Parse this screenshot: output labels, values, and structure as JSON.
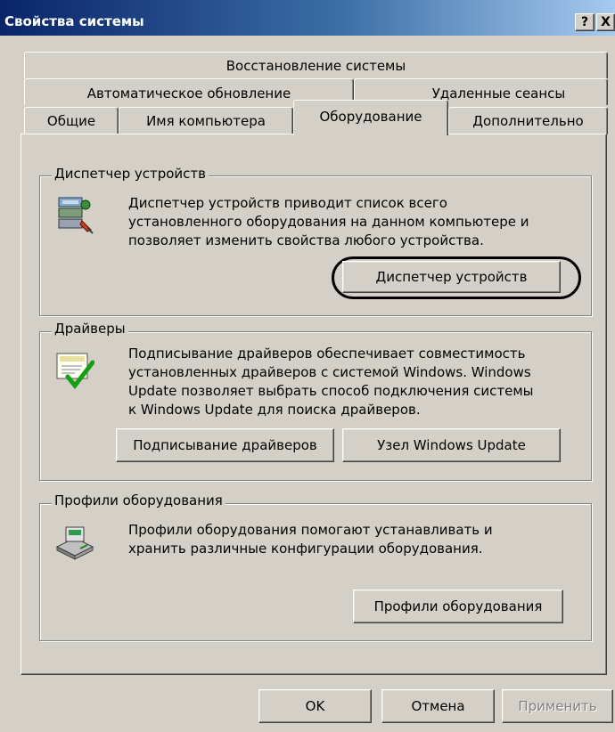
{
  "window": {
    "title": "Свойства системы",
    "help_label": "?",
    "close_label": "X"
  },
  "tabs": {
    "row1": [
      "Восстановление системы"
    ],
    "row2": [
      "Автоматическое обновление",
      "Удаленные сеансы"
    ],
    "row3": [
      "Общие",
      "Имя компьютера",
      "Оборудование",
      "Дополнительно"
    ],
    "active": "Оборудование"
  },
  "device_manager": {
    "legend": "Диспетчер устройств",
    "icon": "device-manager-icon",
    "lines": [
      "Диспетчер устройств приводит список всего",
      "установленного оборудования на данном компьютере и",
      "позволяет изменить свойства любого устройства."
    ],
    "button": "Диспетчер устройств"
  },
  "drivers": {
    "legend": "Драйверы",
    "icon": "driver-signing-icon",
    "lines": [
      "Подписывание драйверов обеспечивает совместимость",
      "установленных драйверов с системой Windows.  Windows",
      "Update позволяет выбрать способ подключения системы",
      "к Windows Update для поиска драйверов."
    ],
    "signing_button": "Подписывание драйверов",
    "update_button": "Узел Windows Update"
  },
  "hardware_profiles": {
    "legend": "Профили оборудования",
    "icon": "hardware-profiles-icon",
    "lines": [
      "Профили оборудования помогают устанавливать и",
      "хранить различные конфигурации оборудования."
    ],
    "button": "Профили оборудования"
  },
  "footer": {
    "ok": "OK",
    "cancel": "Отмена",
    "apply": "Применить"
  },
  "colors": {
    "title_start": "#0a246a",
    "title_end": "#a6caf0",
    "face": "#d4d0c8"
  }
}
